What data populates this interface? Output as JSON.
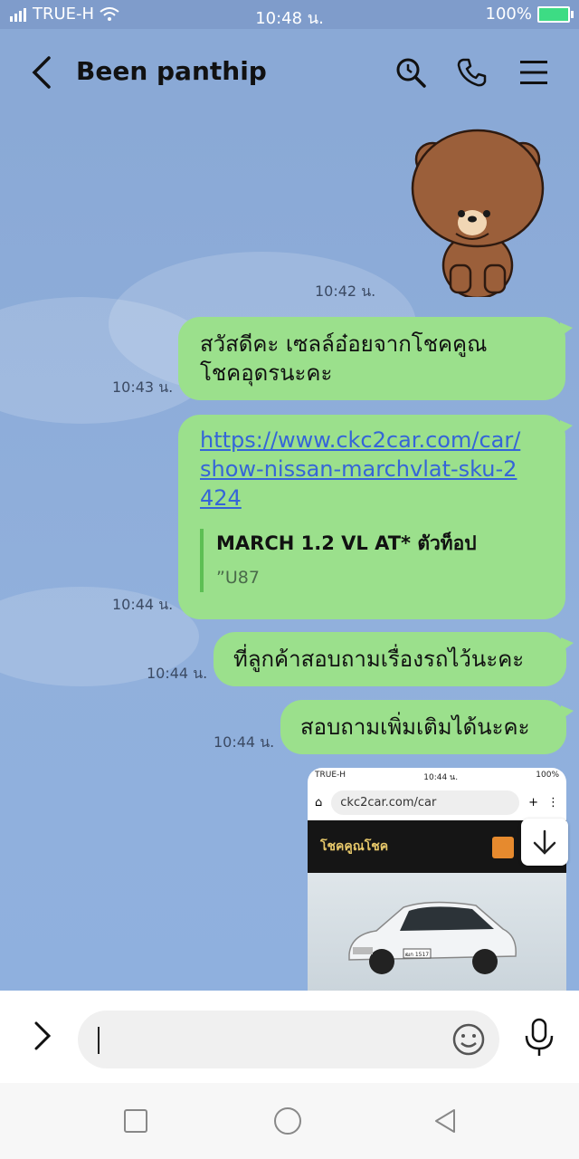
{
  "status_bar": {
    "carrier": "TRUE-H",
    "time": "10:48 น.",
    "battery": "100%"
  },
  "header": {
    "title": "Been panthip"
  },
  "messages": [
    {
      "type": "sticker",
      "time": "10:42 น."
    },
    {
      "type": "text",
      "text_line1": "สวัสดีคะ เซลล์อ๋อยจากโชคคูณ",
      "text_line2": "โชคอุดรนะคะ",
      "time": "10:43 น."
    },
    {
      "type": "link",
      "url": "https://www.ckc2car.com/car/show-nissan-marchvlat-sku-2424",
      "preview_title": "MARCH 1.2 VL AT* ตัวท็อป",
      "preview_desc": "”U87",
      "time": "10:44 น."
    },
    {
      "type": "text",
      "text": "ที่ลูกค้าสอบถามเรื่องรถไว้นะคะ",
      "time": "10:44 น."
    },
    {
      "type": "text",
      "text": "สอบถามเพิ่มเติมได้นะคะ",
      "time": "10:44 น."
    }
  ],
  "screenshot": {
    "carrier": "TRUE-H",
    "time": "10:44 น.",
    "battery": "100%",
    "url": "ckc2car.com/car",
    "site_name": "โชคคูณโชค",
    "plate": "ฒก 1517"
  },
  "icons": {
    "back": "chevron-left-icon",
    "search": "search-clock-icon",
    "call": "phone-icon",
    "menu": "hamburger-icon",
    "emoji": "smiley-icon",
    "mic": "microphone-icon",
    "expand": "chevron-right-icon",
    "scroll_down": "arrow-down-icon"
  },
  "colors": {
    "chat_bg": "#8aa9d6",
    "bubble": "#9be08c",
    "link": "#3565d8",
    "preview_bar": "#5dbf54"
  }
}
